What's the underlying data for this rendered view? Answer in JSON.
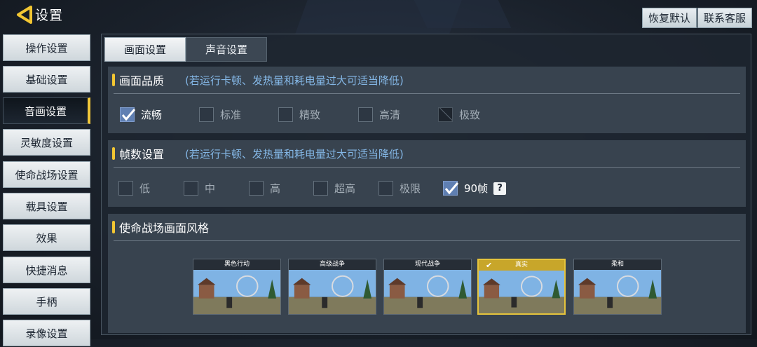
{
  "header": {
    "title": "设置",
    "restore_label": "恢复默认",
    "contact_label": "联系客服"
  },
  "sidebar": {
    "items": [
      {
        "label": "操作设置"
      },
      {
        "label": "基础设置"
      },
      {
        "label": "音画设置"
      },
      {
        "label": "灵敏度设置"
      },
      {
        "label": "使命战场设置"
      },
      {
        "label": "载具设置"
      },
      {
        "label": "效果"
      },
      {
        "label": "快捷消息"
      },
      {
        "label": "手柄"
      },
      {
        "label": "录像设置"
      }
    ],
    "active_index": 2
  },
  "tabs": [
    {
      "label": "画面设置",
      "active": true
    },
    {
      "label": "声音设置",
      "active": false
    }
  ],
  "quality": {
    "title": "画面品质",
    "hint": "(若运行卡顿、发热量和耗电量过大可适当降低)",
    "options": [
      {
        "label": "流畅",
        "state": "checked"
      },
      {
        "label": "标准",
        "state": "unchecked"
      },
      {
        "label": "精致",
        "state": "unchecked"
      },
      {
        "label": "高清",
        "state": "unchecked"
      },
      {
        "label": "极致",
        "state": "disabled"
      }
    ]
  },
  "fps": {
    "title": "帧数设置",
    "hint": "(若运行卡顿、发热量和耗电量过大可适当降低)",
    "options": [
      {
        "label": "低",
        "state": "unchecked"
      },
      {
        "label": "中",
        "state": "unchecked"
      },
      {
        "label": "高",
        "state": "unchecked"
      },
      {
        "label": "超高",
        "state": "unchecked"
      },
      {
        "label": "极限",
        "state": "unchecked"
      },
      {
        "label": "90帧",
        "state": "checked"
      }
    ],
    "help_label": "?"
  },
  "style": {
    "title": "使命战场画面风格",
    "cards": [
      {
        "label": "黑色行动",
        "selected": false
      },
      {
        "label": "高级战争",
        "selected": false
      },
      {
        "label": "现代战争",
        "selected": false
      },
      {
        "label": "真实",
        "selected": true
      },
      {
        "label": "柔和",
        "selected": false
      }
    ]
  },
  "colors": {
    "accent": "#f2c632",
    "hint": "#84b7e6",
    "checked": "#5f7fb2"
  }
}
